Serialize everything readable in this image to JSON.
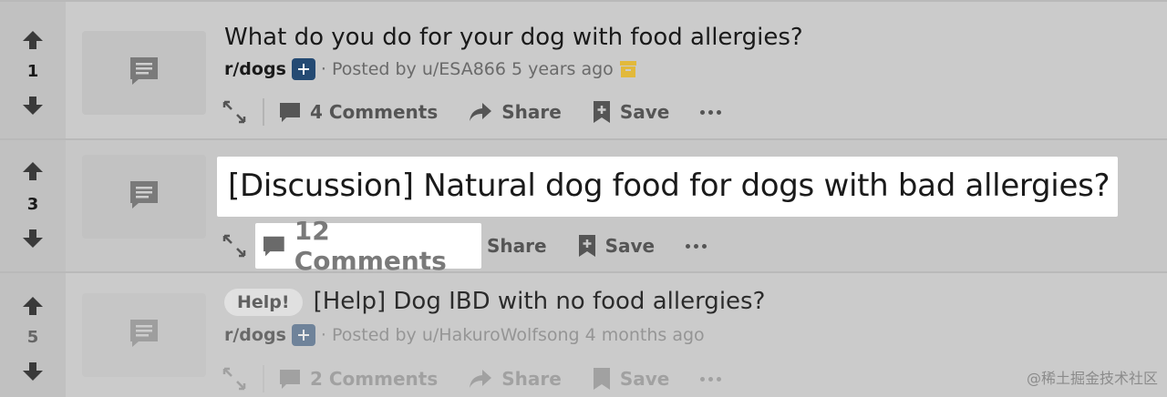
{
  "posts": [
    {
      "votes": "1",
      "title": "What do you do for your dog with food allergies?",
      "subreddit": "r/dogs",
      "posted_by": "· Posted by u/ESA866 5 years ago",
      "comments": "4 Comments",
      "share": "Share",
      "save": "Save"
    },
    {
      "votes": "3",
      "title": "[Discussion] Natural dog food for dogs with bad allergies?",
      "comments": "12 Comments",
      "share": "Share",
      "save": "Save"
    },
    {
      "votes": "5",
      "flair": "Help!",
      "title": "[Help] Dog IBD with no food allergies?",
      "subreddit": "r/dogs",
      "posted_by": "· Posted by u/HakuroWolfsong 4 months ago",
      "comments": "2 Comments",
      "share": "Share",
      "save": "Save"
    }
  ],
  "watermark": "@稀土掘金技术社区",
  "colors": {
    "background": "#c9c9c9",
    "highlight": "#ffffff",
    "subreddit_plus": "#244a73",
    "archive_icon": "#e2b93b"
  },
  "icons": [
    "upvote-arrow-icon",
    "downvote-arrow-icon",
    "text-post-icon",
    "expand-icon",
    "comment-icon",
    "share-icon",
    "save-icon",
    "more-icon",
    "archive-icon"
  ]
}
